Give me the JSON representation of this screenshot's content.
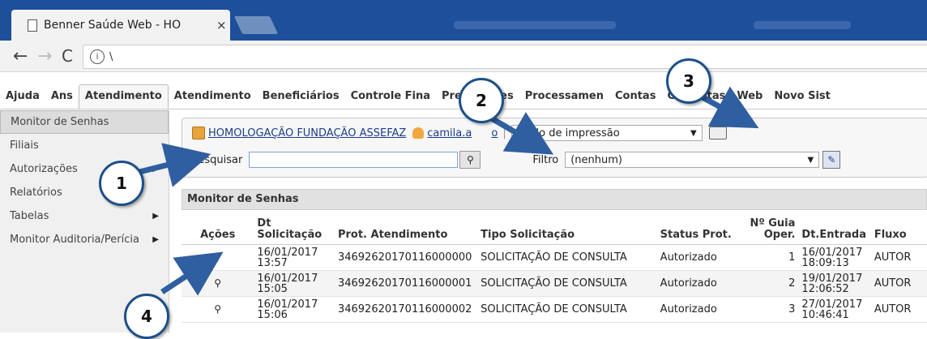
{
  "browser": {
    "tab_title": "Benner Saúde Web - HO",
    "tab_close": "×",
    "url": "\\"
  },
  "menu": {
    "items": [
      "Ajuda",
      "Ans",
      "Atendimento",
      "Atendimento",
      "Beneficiários",
      "Controle Fina",
      "Prestadores",
      "Processamen",
      "Contas",
      "Consultas",
      "Web",
      "Novo Sist"
    ],
    "active_index": 2
  },
  "sidebar": {
    "items": [
      {
        "label": "Monitor de Senhas",
        "has_submenu": false
      },
      {
        "label": "Filiais",
        "has_submenu": false
      },
      {
        "label": "Autorizações",
        "has_submenu": true
      },
      {
        "label": "Relatórios",
        "has_submenu": false
      },
      {
        "label": "Tabelas",
        "has_submenu": true
      },
      {
        "label": "Monitor Auditoria/Perícia",
        "has_submenu": true
      }
    ]
  },
  "toolbar": {
    "company_link": "HOMOLOGAÇÃO FUNDAÇÃO ASSEFAZ",
    "user_link": "camila.a",
    "user_link_tail": "o",
    "print_mode": "Modo de impressão",
    "search_label": "Pesquisar",
    "search_value": "",
    "filter_label": "Filtro",
    "filter_value": "(nenhum)"
  },
  "grid": {
    "title": "Monitor de Senhas",
    "columns": [
      "Ações",
      "Dt Solicitação",
      "Prot. Atendimento",
      "Tipo Solicitação",
      "Status Prot.",
      "Nº Guia Oper.",
      "Dt.Entrada",
      "Fluxo"
    ],
    "rows": [
      {
        "date": "16/01/2017",
        "time": "13:57",
        "prot": "34692620170116000000",
        "tipo": "SOLICITAÇÃO DE CONSULTA",
        "status": "Autorizado",
        "guia": "1",
        "entrada_date": "16/01/2017",
        "entrada_time": "18:09:13",
        "fluxo": "AUTOR"
      },
      {
        "date": "16/01/2017",
        "time": "15:05",
        "prot": "34692620170116000001",
        "tipo": "SOLICITAÇÃO DE CONSULTA",
        "status": "Autorizado",
        "guia": "2",
        "entrada_date": "19/01/2017",
        "entrada_time": "12:06:52",
        "fluxo": "AUTOR"
      },
      {
        "date": "16/01/2017",
        "time": "15:06",
        "prot": "34692620170116000002",
        "tipo": "SOLICITAÇÃO DE CONSULTA",
        "status": "Autorizado",
        "guia": "3",
        "entrada_date": "27/01/2017",
        "entrada_time": "10:46:41",
        "fluxo": "AUTOR"
      }
    ]
  },
  "callouts": [
    "1",
    "2",
    "3",
    "4"
  ],
  "colors": {
    "chrome_blue": "#1d4f9a",
    "callout_border": "#1b4f8a",
    "arrow": "#2f5fa0"
  },
  "icons": [
    "page-icon",
    "back-arrow-icon",
    "forward-arrow-icon",
    "reload-icon",
    "info-icon",
    "package-icon",
    "user-icon",
    "printer-icon",
    "search-icon",
    "edit-icon",
    "magnifier-icon"
  ]
}
